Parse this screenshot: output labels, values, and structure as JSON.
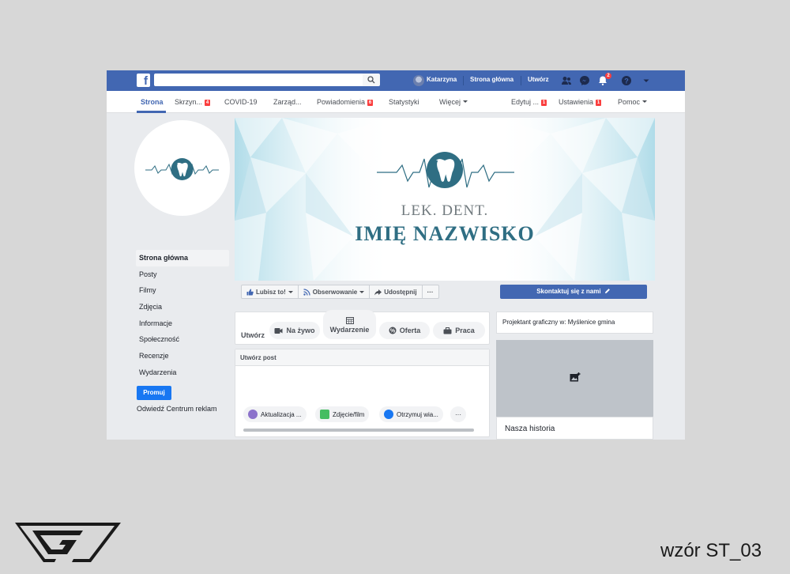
{
  "topbar": {
    "logo": "f",
    "search": {
      "value": "",
      "placeholder": ""
    },
    "user_name": "Katarzyna",
    "home_label": "Strona główna",
    "create_label": "Utwórz",
    "notifications_count": "2",
    "icons": [
      "friends-icon",
      "messenger-icon",
      "bell-icon",
      "help-icon",
      "chevron-down-icon"
    ]
  },
  "tabs": {
    "home": "Strona",
    "inbox": {
      "label": "Skrzyn...",
      "badge": "4"
    },
    "covid": "COVID-19",
    "manage": "Zarząd...",
    "notifications": {
      "label": "Powiadomienia",
      "badge": "6"
    },
    "stats": "Statystyki",
    "more": "Więcej",
    "edit": {
      "label": "Edytuj ...",
      "badge": "1"
    },
    "settings": {
      "label": "Ustawienia",
      "badge": "1"
    },
    "help": "Pomoc"
  },
  "left_nav": {
    "items": [
      "Strona główna",
      "Posty",
      "Filmy",
      "Zdjęcia",
      "Informacje",
      "Społeczność",
      "Recenzje",
      "Wydarzenia"
    ],
    "promote": "Promuj",
    "ads_center": "Odwiedź Centrum reklam"
  },
  "cover": {
    "line1": "LEK. DENT.",
    "line2": "IMIĘ NAZWISKO"
  },
  "actions": {
    "like": "Lubisz to!",
    "follow": "Obserwowanie",
    "share": "Udostępnij",
    "more": "···",
    "contact": "Skontaktuj się z nami"
  },
  "create": {
    "label": "Utwórz",
    "live": "Na żywo",
    "event": "Wydarzenie",
    "offer": "Oferta",
    "job": "Praca"
  },
  "post": {
    "title": "Utwórz post",
    "update": "Aktualizacja ...",
    "photo": "Zdjęcie/film",
    "messages": "Otrzymuj wia...",
    "more": "···"
  },
  "right": {
    "category": "Projektant graficzny w: Myślenice gmina",
    "story_title": "Nasza historia"
  },
  "footer": {
    "template_label": "wzór ST_03"
  },
  "colors": {
    "facebook_blue": "#4267b2",
    "button_blue": "#1877f2",
    "teal": "#2f6e83",
    "badge_red": "#fa3e3e",
    "background": "#d7d7d7"
  }
}
